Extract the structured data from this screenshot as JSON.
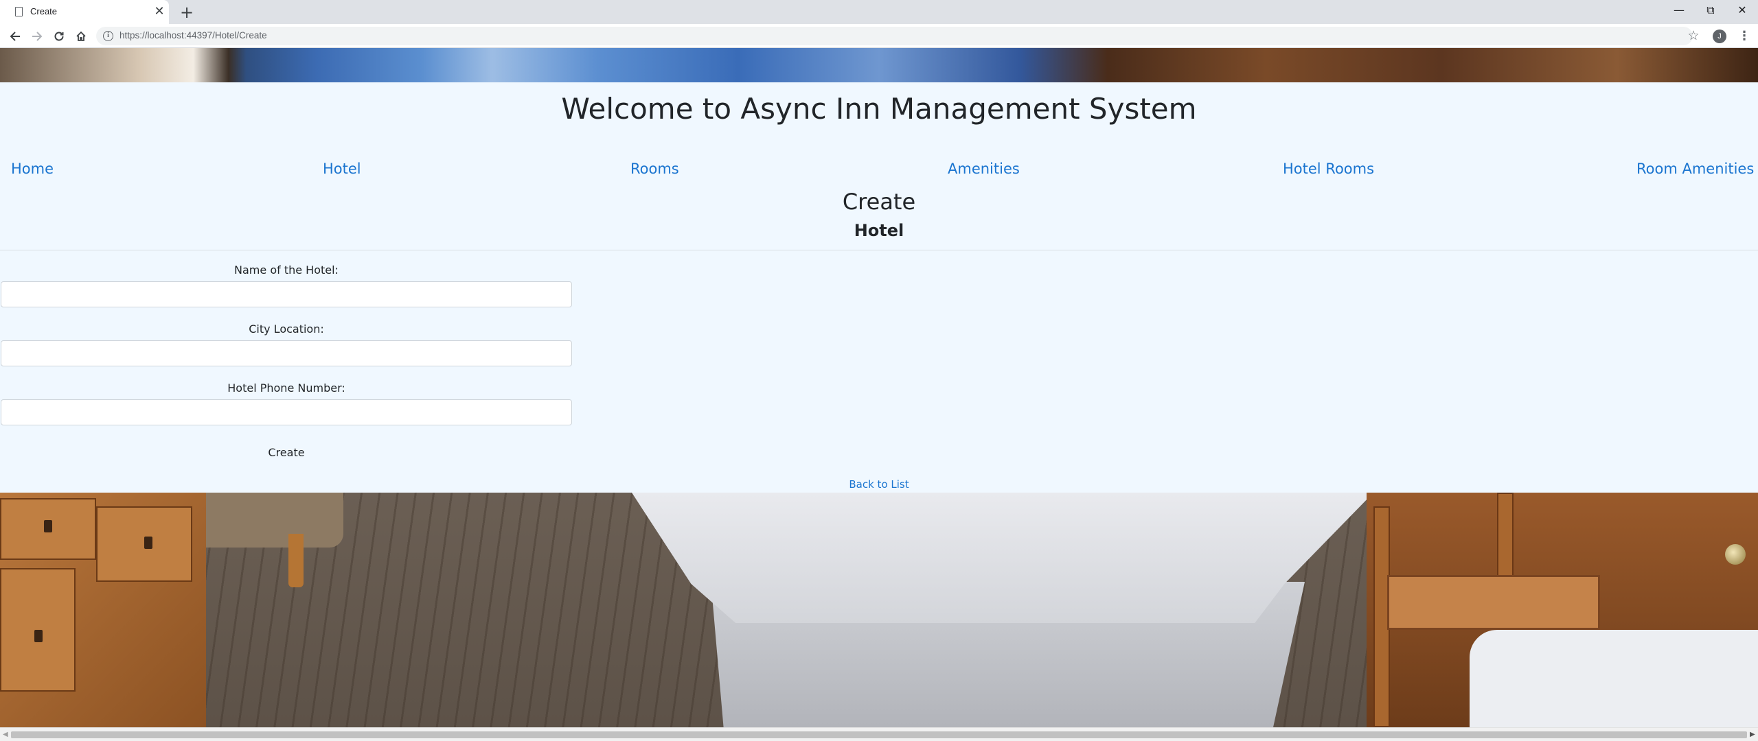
{
  "browser": {
    "tab_title": "Create",
    "new_tab_symbol": "+",
    "close_symbol": "✕",
    "url_host": "https://localhost",
    "url_path": ":44397/Hotel/Create",
    "profile_initial": "J"
  },
  "header": {
    "title": "Welcome to Async Inn Management System"
  },
  "nav": {
    "items": [
      "Home",
      "Hotel",
      "Rooms",
      "Amenities",
      "Hotel Rooms",
      "Room Amenities"
    ]
  },
  "page": {
    "title": "Create",
    "subtitle": "Hotel"
  },
  "form": {
    "fields": [
      {
        "label": "Name of the Hotel:",
        "value": ""
      },
      {
        "label": "City Location:",
        "value": ""
      },
      {
        "label": "Hotel Phone Number:",
        "value": ""
      }
    ],
    "submit_label": "Create"
  },
  "footer": {
    "back_link": "Back to List"
  },
  "colors": {
    "content_bg": "#f0f8ff",
    "link": "#1b75d0",
    "text": "#212529"
  }
}
